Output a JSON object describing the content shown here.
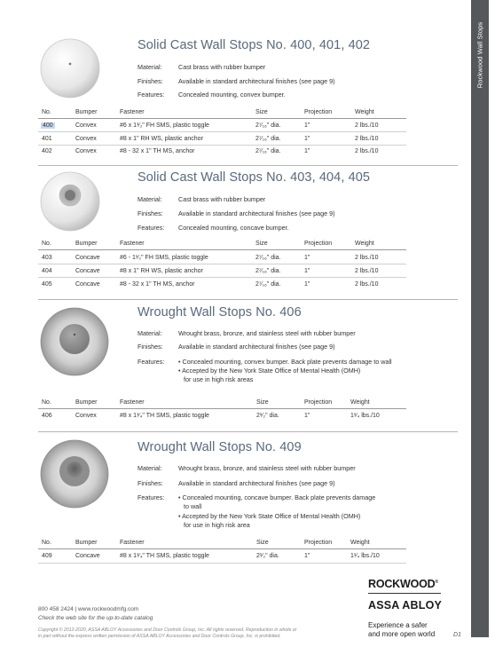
{
  "sidebar": {
    "title": "Rockwood Wall Stops"
  },
  "columns": [
    "No.",
    "Bumper",
    "Fastener",
    "Size",
    "Projection",
    "Weight"
  ],
  "labels": {
    "material": "Material:",
    "finishes": "Finishes:",
    "features": "Features:"
  },
  "sections": [
    {
      "title": "Solid Cast Wall Stops No. 400, 401, 402",
      "material": "Cast brass with rubber bumper",
      "finishes": "Available in standard architectural finishes (see page 9)",
      "features": [
        "Concealed mounting, convex bumper."
      ],
      "rows": [
        [
          "400",
          "Convex",
          "#6 x 1¹⁄₂\" FH SMS, plastic toggle",
          "2⁷⁄₁₆\" dia.",
          "1\"",
          "2 lbs./10"
        ],
        [
          "401",
          "Convex",
          "#8 x 1\" RH WS, plastic anchor",
          "2⁷⁄₁₆\" dia.",
          "1\"",
          "2 lbs./10"
        ],
        [
          "402",
          "Convex",
          "#8 - 32 x 1\" TH MS, anchor",
          "2⁷⁄₁₆\" dia.",
          "1\"",
          "2 lbs./10"
        ]
      ]
    },
    {
      "title": "Solid Cast Wall Stops No. 403, 404, 405",
      "material": "Cast brass with rubber bumper",
      "finishes": "Available in standard architectural finishes (see page 9)",
      "features": [
        "Concealed mounting, concave bumper."
      ],
      "rows": [
        [
          "403",
          "Concave",
          "#6 - 1¹⁄₂\" FH SMS, plastic toggle",
          "2⁷⁄₁₆\" dia.",
          "1\"",
          "2 lbs./10"
        ],
        [
          "404",
          "Concave",
          "#8 x 1\" RH WS, plastic anchor",
          "2⁷⁄₁₆\" dia.",
          "1\"",
          "2 lbs./10"
        ],
        [
          "405",
          "Concave",
          "#8 - 32 x 1\" TH MS, anchor",
          "2⁷⁄₁₆\" dia.",
          "1\"",
          "2 lbs./10"
        ]
      ]
    },
    {
      "title": "Wrought Wall Stops No. 406",
      "material": "Wrought brass, bronze, and stainless steel with rubber bumper",
      "finishes": "Available in standard architectural finishes (see page 9)",
      "features": [
        "• Concealed mounting, convex bumper. Back plate prevents damage to wall",
        "• Accepted by the New York State Office of Mental Health (OMH)",
        "for use in high risk areas"
      ],
      "rows": [
        [
          "406",
          "Convex",
          "#8 x 1¹⁄₄\" TH SMS, plastic toggle",
          "2¹⁄₂\" dia.",
          "1\"",
          "1¹⁄₄ lbs./10"
        ]
      ]
    },
    {
      "title": "Wrought Wall Stops No. 409",
      "material": "Wrought brass, bronze, and stainless steel with rubber bumper",
      "finishes": "Available in standard architectural finishes (see page 9)",
      "features": [
        "• Concealed mounting, concave bumper. Back plate prevents damage",
        "to wall",
        "• Accepted by the New York State Office of Mental Health (OMH)",
        "for use in high risk area"
      ],
      "rows": [
        [
          "409",
          "Concave",
          "#8 x 1¹⁄₄\" TH SMS, plastic toggle",
          "2¹⁄₂\" dia.",
          "1\"",
          "1¹⁄₄ lbs./10"
        ]
      ]
    }
  ],
  "footer": {
    "contact": "800 458 2424  |  www.rockwoodmfg.com",
    "note": "Check the web site for the up-to-date catalog",
    "copyright_1": "Copyright © 2012-2020, ASSA ABLOY Accessories and Door Controls Group, Inc. All rights reserved. Reproduction in whole or",
    "copyright_2": "in part without the express written permission of ASSA ABLOY Accessories and Door Controls Group, Inc. is prohibited.",
    "brand_1": "ROCKWOOD",
    "brand_2": "ASSA ABLOY",
    "tagline_1": "Experience a safer",
    "tagline_2": "and more open world",
    "page_number": "D1"
  }
}
